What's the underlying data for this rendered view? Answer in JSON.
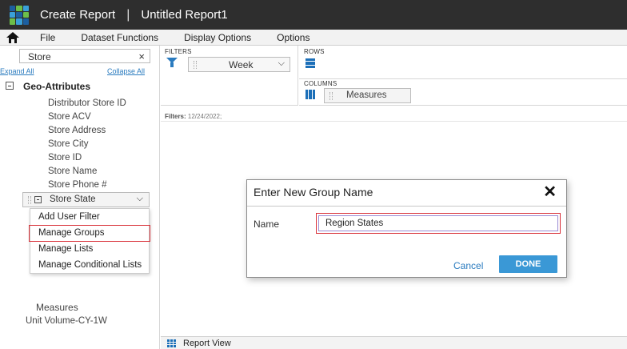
{
  "window": {
    "title": "Create Report",
    "report_name": "Untitled Report1"
  },
  "menu": {
    "items": [
      "File",
      "Dataset Functions",
      "Display Options",
      "Options"
    ]
  },
  "left_panel": {
    "search_value": "Store",
    "expand_all": "Expand All",
    "collapse_all": "Collapse All",
    "group_title": "Geo-Attributes",
    "attributes": [
      "Distributor Store ID",
      "Store ACV",
      "Store Address",
      "Store City",
      "Store ID",
      "Store Name",
      "Store Phone #"
    ],
    "selected_attribute": "Store State",
    "context_menu": [
      "Add User Filter",
      "Manage Groups",
      "Manage Lists",
      "Manage Conditional Lists"
    ],
    "measures_heading": "Measures",
    "measures_item": "Unit Volume-CY-1W"
  },
  "shelves": {
    "filters_label": "FILTERS",
    "filter_value": "Week",
    "rows_label": "ROWS",
    "columns_label": "COLUMNS",
    "columns_value": "Measures",
    "filters_status_label": "Filters:",
    "filters_status_value": "12/24/2022;"
  },
  "dialog": {
    "title": "Enter New Group Name",
    "name_label": "Name",
    "name_value": "Region States",
    "cancel_label": "Cancel",
    "done_label": "DONE"
  },
  "bottom": {
    "tab_label": "Report View"
  },
  "colors": {
    "accent": "#3a98d6",
    "highlight": "#d9323a",
    "titlebar": "#2e2e2e"
  }
}
